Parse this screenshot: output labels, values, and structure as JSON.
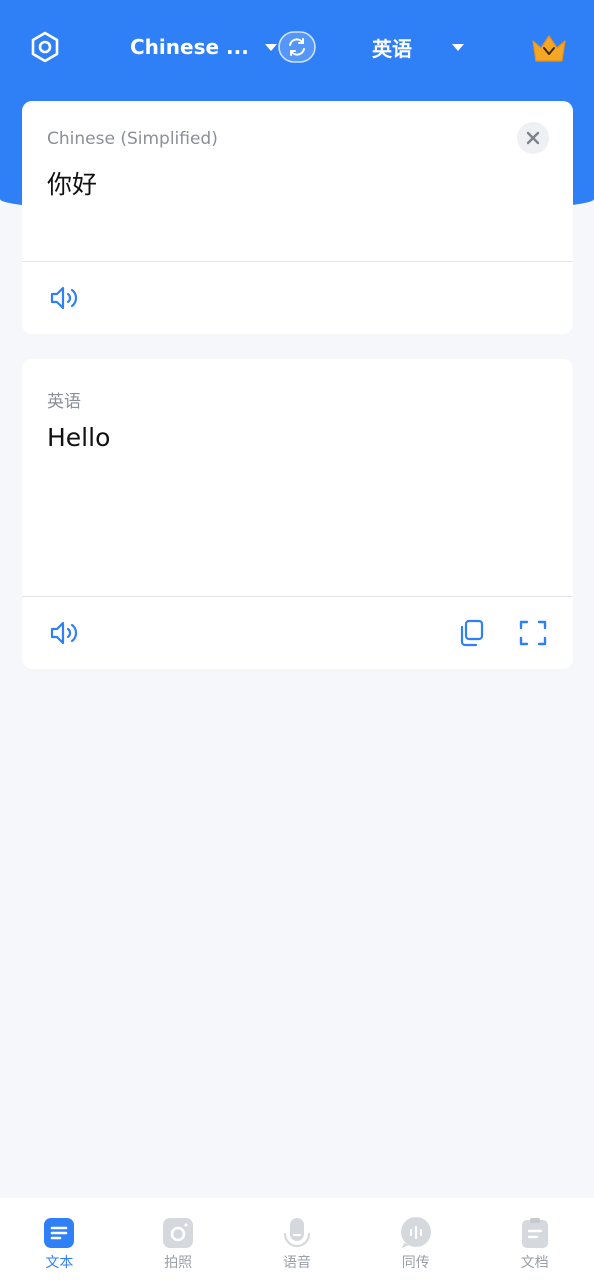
{
  "header": {
    "source_language": "Chinese ...",
    "target_language": "英语",
    "settings_icon": "settings-hex-icon",
    "swap_icon": "swap-icon",
    "premium_icon": "crown-icon"
  },
  "source_card": {
    "language": "Chinese (Simplified)",
    "text": "你好"
  },
  "target_card": {
    "language": "英语",
    "text": "Hello"
  },
  "bottom_nav": {
    "items": [
      {
        "label": "文本",
        "icon": "text-icon",
        "active": true
      },
      {
        "label": "拍照",
        "icon": "camera-icon",
        "active": false
      },
      {
        "label": "语音",
        "icon": "microphone-icon",
        "active": false
      },
      {
        "label": "同传",
        "icon": "interpretation-icon",
        "active": false
      },
      {
        "label": "文档",
        "icon": "document-icon",
        "active": false
      }
    ]
  },
  "colors": {
    "primary": "#2f80f7",
    "background": "#f5f7fa",
    "premium": "#f5a623"
  }
}
